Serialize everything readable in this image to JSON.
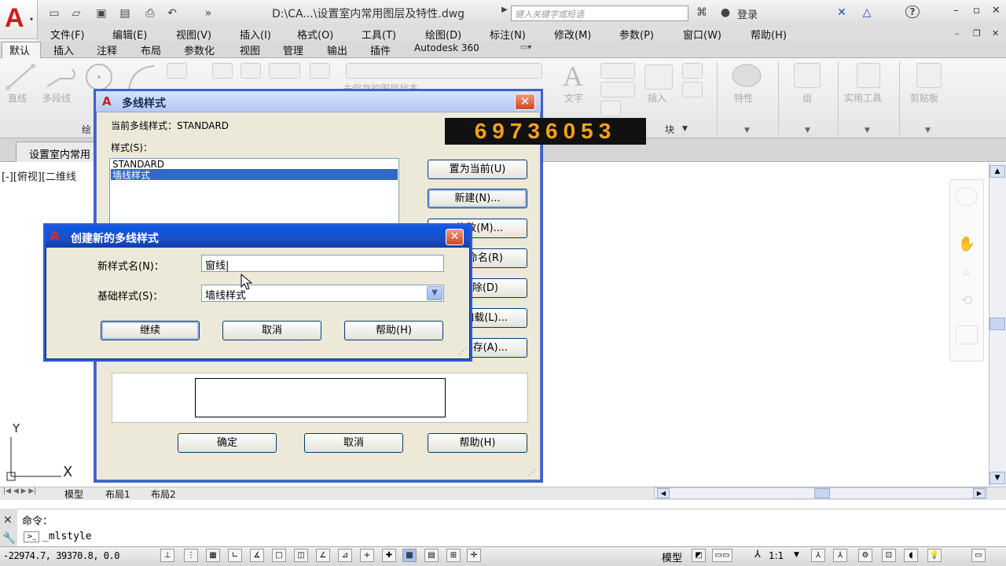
{
  "window": {
    "title": "D:\\CA...\\设置室内常用图层及特性.dwg",
    "search_placeholder": "键入关键字或短语",
    "login": "登录"
  },
  "menu": [
    "文件(F)",
    "编辑(E)",
    "视图(V)",
    "插入(I)",
    "格式(O)",
    "工具(T)",
    "绘图(D)",
    "标注(N)",
    "修改(M)",
    "参数(P)",
    "窗口(W)",
    "帮助(H)"
  ],
  "ribbon_tabs": [
    "默认",
    "插入",
    "注释",
    "布局",
    "参数化",
    "视图",
    "管理",
    "输出",
    "插件",
    "Autodesk 360"
  ],
  "ribbon": {
    "draw_tools": [
      "直线",
      "多段线"
    ],
    "layer_text": "未保存的图层状态",
    "text_label": "文字",
    "insert_label": "插入",
    "block_panel": "块",
    "draw_panel": "绘",
    "properties": "特性",
    "group": "组",
    "utilities": "实用工具",
    "clipboard": "剪贴板"
  },
  "doc_tab": "设置室内常用",
  "viewport_label": "[-][俯视][二维线",
  "counter": "69736053",
  "mls_dialog": {
    "title": "多线样式",
    "current": "当前多线样式：STANDARD",
    "styles_label": "样式(S)：",
    "styles": [
      "STANDARD",
      "墙线样式"
    ],
    "buttons": {
      "set_current": "置为当前(U)",
      "new": "新建(N)...",
      "modify": "修改(M)...",
      "rename": "重命名(R)",
      "delete": "删除(D)",
      "load": "加载(L)...",
      "save": "保存(A)..."
    },
    "ok": "确定",
    "cancel": "取消",
    "help": "帮助(H)"
  },
  "new_dialog": {
    "title": "创建新的多线样式",
    "name_label": "新样式名(N)：",
    "name_value": "窗线|",
    "base_label": "基础样式(S)：",
    "base_value": "墙线样式",
    "continue": "继续",
    "cancel": "取消",
    "help": "帮助(H)"
  },
  "layout_tabs": [
    "模型",
    "布局1",
    "布局2"
  ],
  "command": {
    "history": "命令：",
    "input": "_mlstyle"
  },
  "status": {
    "coords": "-22974.7, 39370.8, 0.0",
    "model": "模型",
    "scale": "1:1"
  }
}
